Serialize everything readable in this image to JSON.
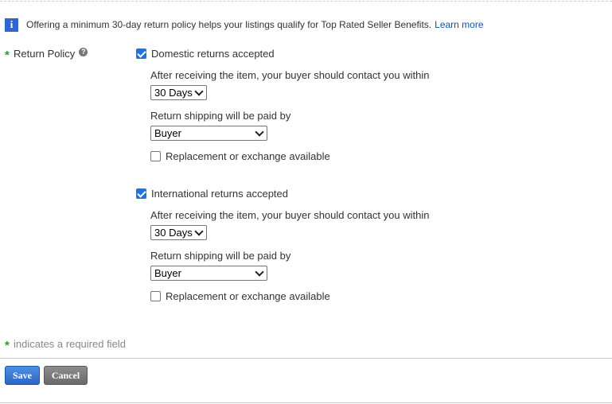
{
  "info": {
    "message": "Offering a minimum 30-day return policy helps your listings qualify for Top Rated Seller Benefits.",
    "link": "Learn more",
    "icon_glyph": "i"
  },
  "form": {
    "required_star": "*",
    "field_label": "Return Policy",
    "help_glyph": "?",
    "domestic": {
      "accepted_label": "Domestic returns accepted",
      "accepted_checked": true,
      "contact_label": "After receiving the item, your buyer should contact you within",
      "contact_value": "30 Days",
      "shipping_label": "Return shipping will be paid by",
      "shipping_value": "Buyer",
      "replacement_label": "Replacement or exchange available",
      "replacement_checked": false
    },
    "international": {
      "accepted_label": "International returns accepted",
      "accepted_checked": true,
      "contact_label": "After receiving the item, your buyer should contact you within",
      "contact_value": "30 Days",
      "shipping_label": "Return shipping will be paid by",
      "shipping_value": "Buyer",
      "replacement_label": "Replacement or exchange available",
      "replacement_checked": false
    },
    "required_note": "indicates a required field"
  },
  "actions": {
    "save_label": "Save",
    "cancel_label": "Cancel"
  },
  "colors": {
    "info_icon": "#3366cc",
    "link": "#0654ba",
    "required_star": "#2c9a2c",
    "checkbox_checked": "#1a73e8",
    "save_button": "#2a68c4",
    "cancel_button": "#6a6a6a"
  }
}
